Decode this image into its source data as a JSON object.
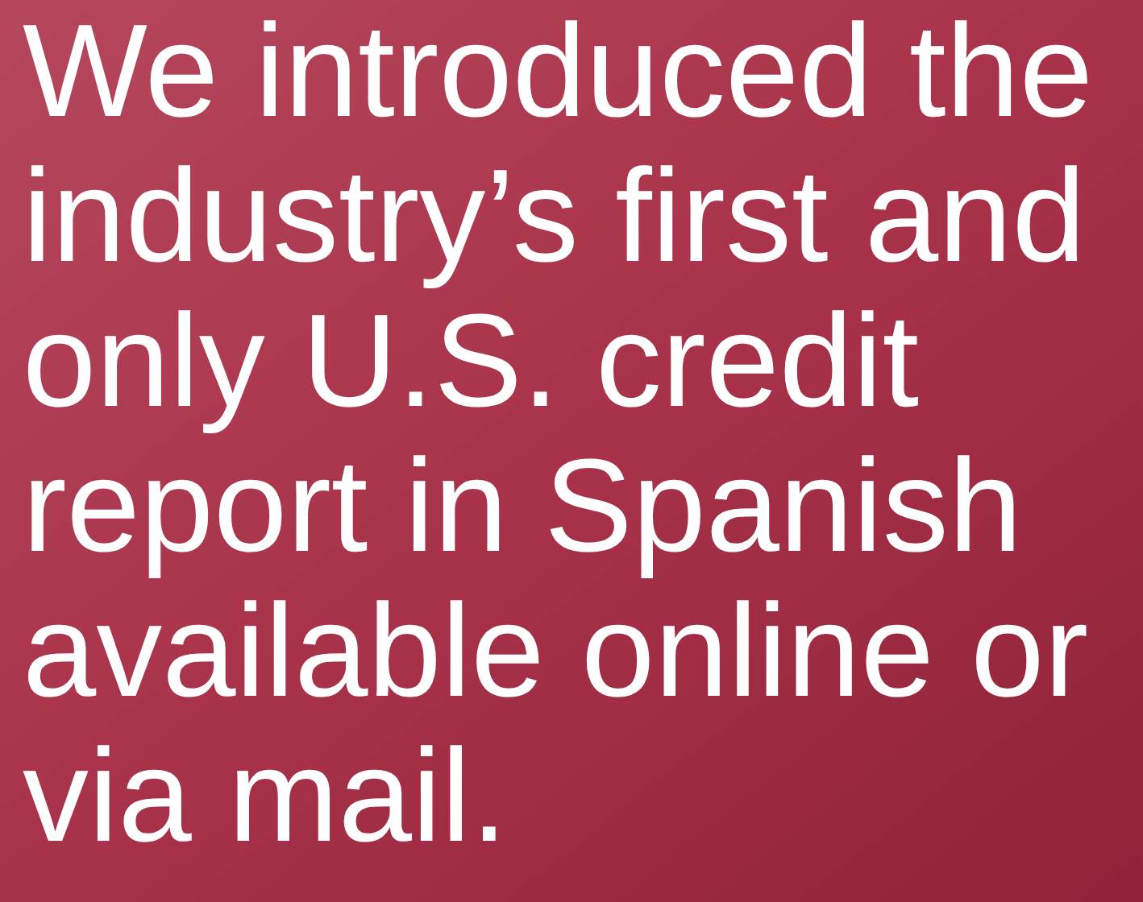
{
  "hero": {
    "headline": "We introduced the industry’s first and only U.S. credit report in Spanish available online or via mail."
  }
}
